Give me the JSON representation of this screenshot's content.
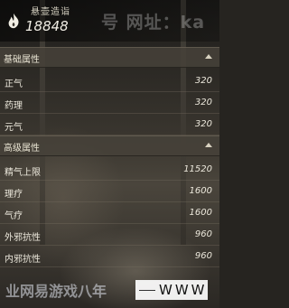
{
  "header": {
    "title": "悬壶造诣",
    "score": "18848",
    "watermark": "号 网址：ka"
  },
  "sections": [
    {
      "label": "基础属性",
      "rows": [
        {
          "name": "正气",
          "value": "320"
        },
        {
          "name": "药理",
          "value": "320"
        },
        {
          "name": "元气",
          "value": "320"
        }
      ]
    },
    {
      "label": "高级属性",
      "rows": [
        {
          "name": "精气上限",
          "value": "11520"
        },
        {
          "name": "理疗",
          "value": "1600"
        },
        {
          "name": "气疗",
          "value": "1600"
        },
        {
          "name": "外邪抗性",
          "value": "960"
        },
        {
          "name": "内邪抗性",
          "value": "960"
        }
      ]
    }
  ],
  "footer_watermark": {
    "text": "业网易游戏八年",
    "url": "WWW"
  },
  "colors": {
    "section_bg": "#46423a",
    "text": "#ece8dc"
  },
  "icons": {
    "emblem": "flame-emblem-icon",
    "collapse": "caret-up-icon"
  }
}
